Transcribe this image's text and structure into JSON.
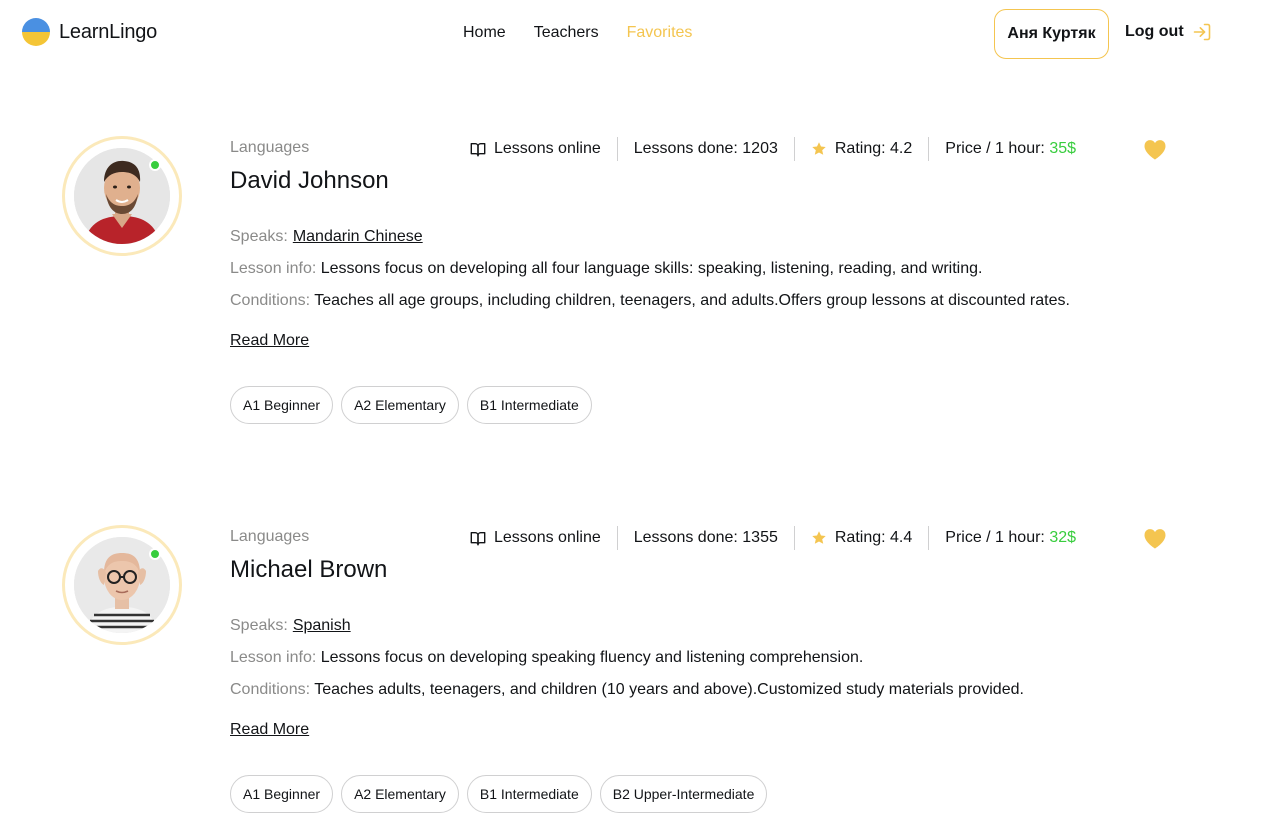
{
  "header": {
    "logo_text": "LearnLingo",
    "nav": {
      "home": "Home",
      "teachers": "Teachers",
      "favorites": "Favorites"
    },
    "user_name": "Аня Куртяк",
    "logout": "Log out",
    "accent": "#f4c550"
  },
  "labels": {
    "languages": "Languages",
    "lessons_online": "Lessons online",
    "lessons_done_prefix": "Lessons done: ",
    "rating_prefix": "Rating: ",
    "price_prefix": "Price / 1 hour: ",
    "speaks": "Speaks:",
    "lesson_info": "Lesson info:",
    "conditions": "Conditions:",
    "read_more": "Read More"
  },
  "teachers": [
    {
      "name": "David Johnson",
      "lessons_done": "1203",
      "rating": "4.2",
      "price": "35$",
      "speaks": "Mandarin Chinese",
      "lesson_info": "Lessons focus on developing all four language skills: speaking, listening, reading, and writing.",
      "conditions": "Teaches all age groups, including children, teenagers, and adults.Offers group lessons at discounted rates.",
      "levels": [
        "A1 Beginner",
        "A2 Elementary",
        "B1 Intermediate"
      ],
      "favorited": true
    },
    {
      "name": "Michael Brown",
      "lessons_done": "1355",
      "rating": "4.4",
      "price": "32$",
      "speaks": "Spanish",
      "lesson_info": "Lessons focus on developing speaking fluency and listening comprehension.",
      "conditions": "Teaches adults, teenagers, and children (10 years and above).Customized study materials provided.",
      "levels": [
        "A1 Beginner",
        "A2 Elementary",
        "B1 Intermediate",
        "B2 Upper-Intermediate"
      ],
      "favorited": true
    }
  ],
  "colors": {
    "online": "#38cd3e",
    "price": "#38cd3e",
    "star": "#f4c550",
    "heart": "#f4c550",
    "avatar_ring": "#fbe9ba",
    "muted_text": "#8a8a89"
  }
}
